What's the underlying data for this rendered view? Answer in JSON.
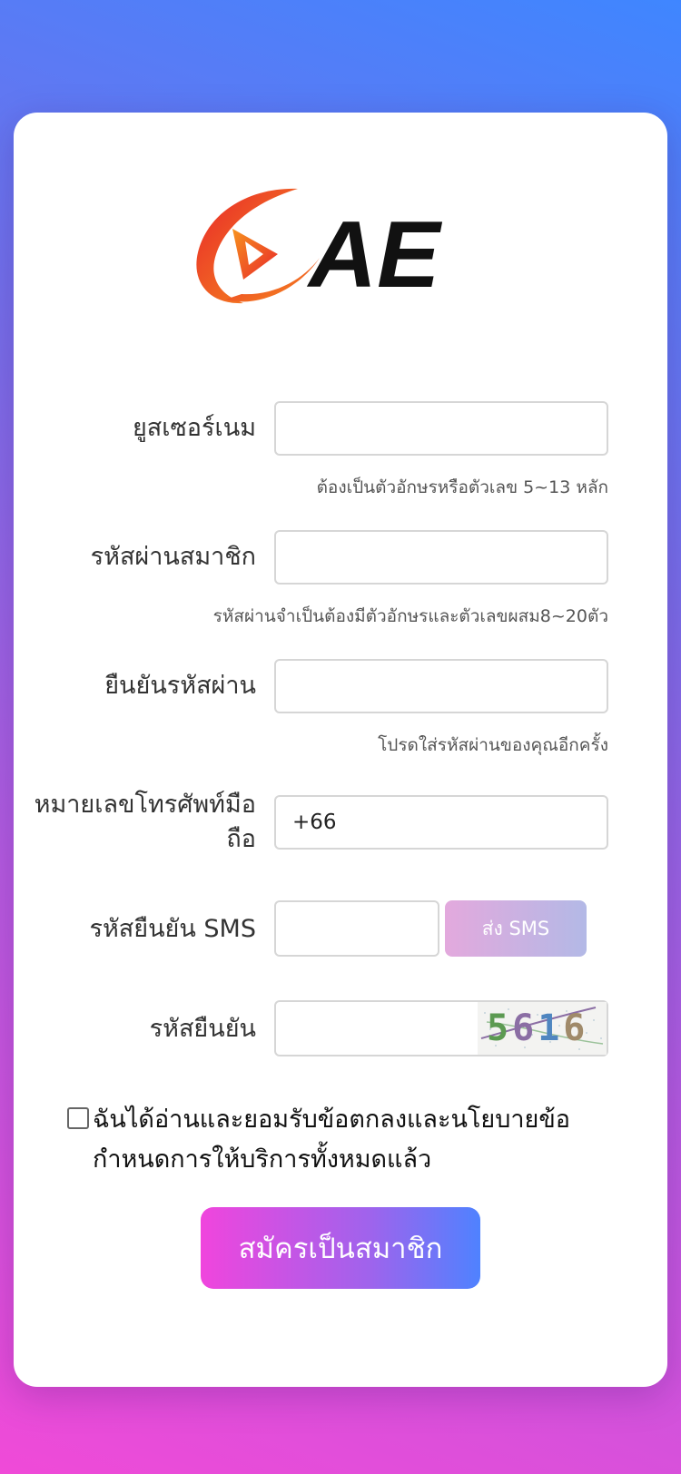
{
  "logo": {
    "text": "AE"
  },
  "form": {
    "username": {
      "label": "ยูสเซอร์เนม",
      "value": "",
      "hint": "ต้องเป็นตัวอักษรหรือตัวเลข 5~13 หลัก"
    },
    "password": {
      "label": "รหัสผ่านสมาชิก",
      "value": "",
      "hint": "รหัสผ่านจำเป็นต้องมีตัวอักษรและตัวเลขผสม8~20ตัว"
    },
    "confirm_password": {
      "label": "ยืนยันรหัสผ่าน",
      "value": "",
      "hint": "โปรดใส่รหัสผ่านของคุณอีกครั้ง"
    },
    "phone": {
      "label": "หมายเลขโทรศัพท์มือถือ",
      "value": "+66"
    },
    "sms_code": {
      "label": "รหัสยืนยัน SMS",
      "value": "",
      "button_label": "ส่ง SMS"
    },
    "captcha": {
      "label": "รหัสยืนยัน",
      "value": "",
      "digits": [
        "5",
        "6",
        "1",
        "6"
      ]
    },
    "agree_label": "ฉันได้อ่านและยอมรับข้อตกลงและนโยบายข้อกำหนดการให้บริการทั้งหมดแล้ว",
    "submit_label": "สมัครเป็นสมาชิก"
  },
  "colors": {
    "background_start": "#f04ad8",
    "background_end": "#3f86ff",
    "submit_start": "#f045dd",
    "submit_end": "#4f82ff",
    "logo_red": "#e8262a",
    "logo_orange": "#f7931e"
  }
}
